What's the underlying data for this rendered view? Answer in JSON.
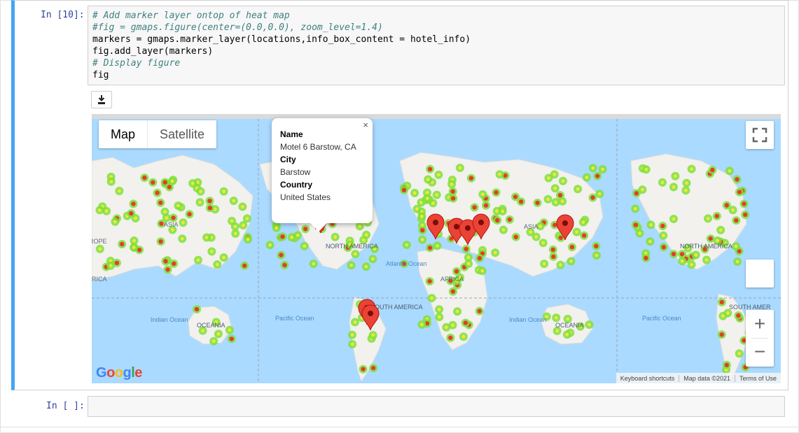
{
  "cells": {
    "code_cell": {
      "prompt": "In [10]:",
      "lines": [
        {
          "text": "# Add marker layer ontop of heat map",
          "kind": "comment"
        },
        {
          "text": "#fig = gmaps.figure(center=(0.0,0.0), zoom_level=1.4)",
          "kind": "comment"
        },
        {
          "text": "markers = gmaps.marker_layer(locations,info_box_content = hotel_info)",
          "kind": "code"
        },
        {
          "text": "fig.add_layer(markers)",
          "kind": "code"
        },
        {
          "text": "# Display figure",
          "kind": "comment"
        },
        {
          "text": "fig",
          "kind": "code"
        }
      ]
    },
    "empty_cell": {
      "prompt": "In [ ]:"
    }
  },
  "download_icon": "download-icon",
  "map": {
    "type_control": {
      "map_label": "Map",
      "satellite_label": "Satellite",
      "active": "Map"
    },
    "fullscreen_icon": "fullscreen-icon",
    "zoom_in_label": "+",
    "zoom_out_label": "−",
    "info_window": {
      "name_label": "Name",
      "name_value": "Motel 6 Barstow, CA",
      "city_label": "City",
      "city_value": "Barstow",
      "country_label": "Country",
      "country_value": "United States",
      "close_label": "×"
    },
    "place_labels": [
      "ASIA",
      "ROPE",
      "RICA",
      "NORTH AMERICA",
      "Atlantic Ocean",
      "AFRICA",
      "ASIA",
      "NORTH AMERICA",
      "SOUTH AMERICA",
      "Indian Ocean",
      "OCEANIA",
      "Pacific Ocean",
      "Indian Ocean",
      "OCEANIA",
      "Pacific Ocean",
      "SOUTH AMER"
    ],
    "attribution": {
      "logo": "Google",
      "keyboard": "Keyboard shortcuts",
      "map_data": "Map data ©2021",
      "terms": "Terms of Use"
    },
    "colors": {
      "ocean": "#aadaff",
      "land": "#f2f1ee",
      "heat_low": "#7fe03b",
      "heat_mid": "#f5e83a",
      "heat_high": "#e8342c",
      "marker": "#ea4335"
    }
  }
}
